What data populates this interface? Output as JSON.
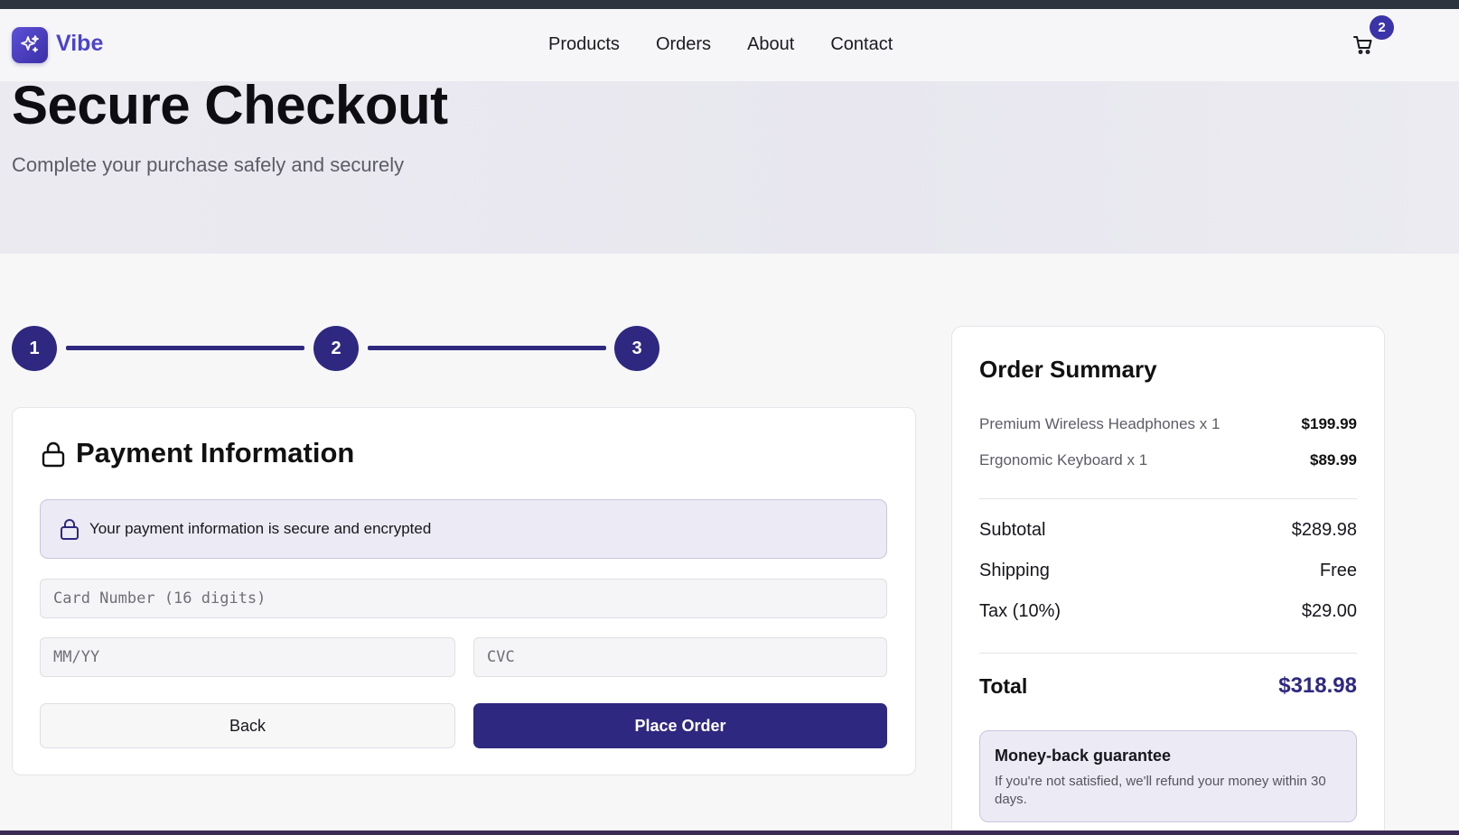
{
  "brand": {
    "name": "Vibe",
    "logo_icon": "sparkles-icon",
    "accent_color": "#2e2880"
  },
  "nav": {
    "links": [
      "Products",
      "Orders",
      "About",
      "Contact"
    ]
  },
  "cart": {
    "icon": "cart-icon",
    "count": "2"
  },
  "hero": {
    "title": "Secure Checkout",
    "subtitle": "Complete your purchase safely and securely"
  },
  "stepper": {
    "steps": [
      "1",
      "2",
      "3"
    ],
    "current_step": 3
  },
  "payment": {
    "title": "Payment Information",
    "title_icon": "lock-icon",
    "secure_note": "Your payment information is secure and encrypted",
    "card_number_placeholder": "Card Number (16 digits)",
    "expiry_placeholder": "MM/YY",
    "cvc_placeholder": "CVC",
    "back_label": "Back",
    "place_order_label": "Place Order"
  },
  "summary": {
    "title": "Order Summary",
    "items": [
      {
        "name": "Premium Wireless Headphones x 1",
        "price": "$199.99"
      },
      {
        "name": "Ergonomic Keyboard x 1",
        "price": "$89.99"
      }
    ],
    "subtotal_label": "Subtotal",
    "subtotal_value": "$289.98",
    "shipping_label": "Shipping",
    "shipping_value": "Free",
    "tax_label": "Tax (10%)",
    "tax_value": "$29.00",
    "total_label": "Total",
    "total_value": "$318.98",
    "guarantee_title": "Money-back guarantee",
    "guarantee_text": "If you're not satisfied, we'll refund your money within 30 days."
  }
}
